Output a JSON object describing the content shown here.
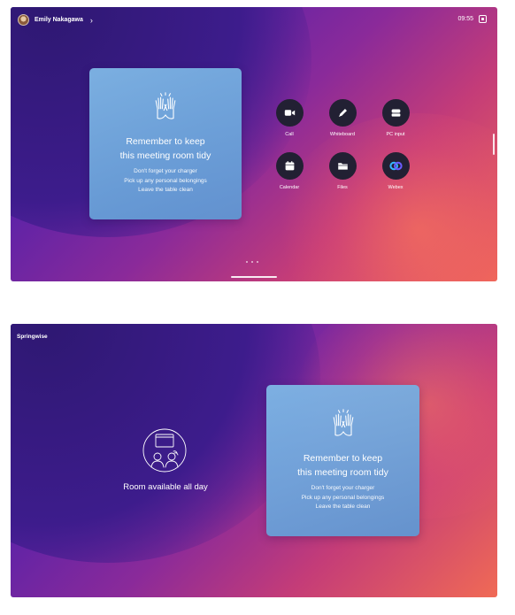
{
  "top_screen": {
    "user_name": "Emily Nakagawa",
    "user_chevron": "›",
    "time": "09:55",
    "card": {
      "title_line1": "Remember to keep",
      "title_line2": "this meeting room tidy",
      "lines": [
        "Don't forget your charger",
        "Pick up any personal belongings",
        "Leave the table clean"
      ]
    },
    "apps": [
      {
        "label": "Call",
        "icon": "video-camera-icon"
      },
      {
        "label": "Whiteboard",
        "icon": "pencil-icon"
      },
      {
        "label": "PC input",
        "icon": "pc-input-icon"
      },
      {
        "label": "Calendar",
        "icon": "calendar-icon"
      },
      {
        "label": "Files",
        "icon": "folder-icon"
      },
      {
        "label": "Webex",
        "icon": "webex-icon"
      }
    ]
  },
  "bottom_screen": {
    "brand": "Springwise",
    "room_status": "Room available all day",
    "card": {
      "title_line1": "Remember to keep",
      "title_line2": "this meeting room tidy",
      "lines": [
        "Don't forget your charger",
        "Pick up any personal belongings",
        "Leave the table clean"
      ]
    }
  },
  "colors": {
    "app_circle": "#222033",
    "card_blue": "#7fb7e6",
    "wallpaper_purple": "#5a22a8",
    "wallpaper_orange": "#f06a55"
  }
}
